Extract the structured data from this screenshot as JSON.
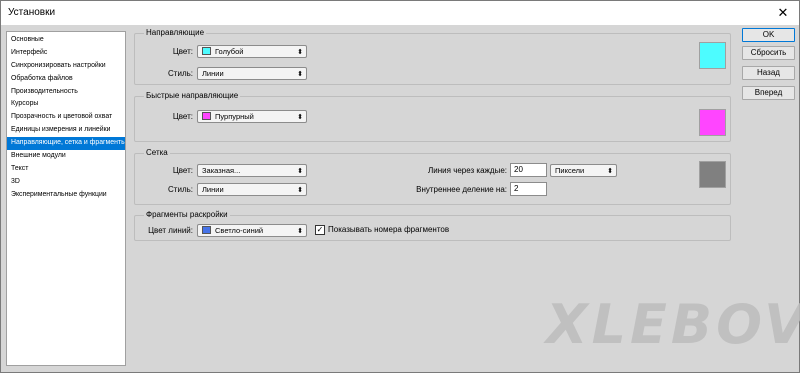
{
  "window": {
    "title": "Установки",
    "close_glyph": "✕"
  },
  "sidebar": {
    "items": [
      "Основные",
      "Интерфейс",
      "Синхронизировать настройки",
      "Обработка файлов",
      "Производительность",
      "Курсоры",
      "Прозрачность и цветовой охват",
      "Единицы измерения и линейки",
      "Направляющие, сетка и фрагменты",
      "Внешние модули",
      "Текст",
      "3D",
      "Экспериментальные функции"
    ],
    "selected_index": 8
  },
  "guides": {
    "title": "Направляющие",
    "color_label": "Цвет:",
    "color_value": "Голубой",
    "color_hex": "#4dfcff",
    "style_label": "Стиль:",
    "style_value": "Линии"
  },
  "smart_guides": {
    "title": "Быстрые направляющие",
    "color_label": "Цвет:",
    "color_value": "Пурпурный",
    "color_hex": "#ff45ff"
  },
  "grid": {
    "title": "Сетка",
    "color_label": "Цвет:",
    "color_value": "Заказная...",
    "color_hex": "#808080",
    "style_label": "Стиль:",
    "style_value": "Линии",
    "gridline_label": "Линия через каждые:",
    "gridline_value": "20",
    "unit_value": "Пиксели",
    "subdiv_label": "Внутреннее деление на:",
    "subdiv_value": "2"
  },
  "slices": {
    "title": "Фрагменты раскройки",
    "line_color_label": "Цвет линий:",
    "line_color_value": "Светло-синий",
    "line_color_hex": "#4673e8",
    "show_numbers_label": "Показывать номера фрагментов",
    "show_numbers_checked": true,
    "check_glyph": "✓"
  },
  "buttons": {
    "ok": "OK",
    "reset": "Сбросить",
    "back": "Назад",
    "next": "Вперед"
  },
  "arrow_glyph": "⬍",
  "watermark": "XLEBOV"
}
